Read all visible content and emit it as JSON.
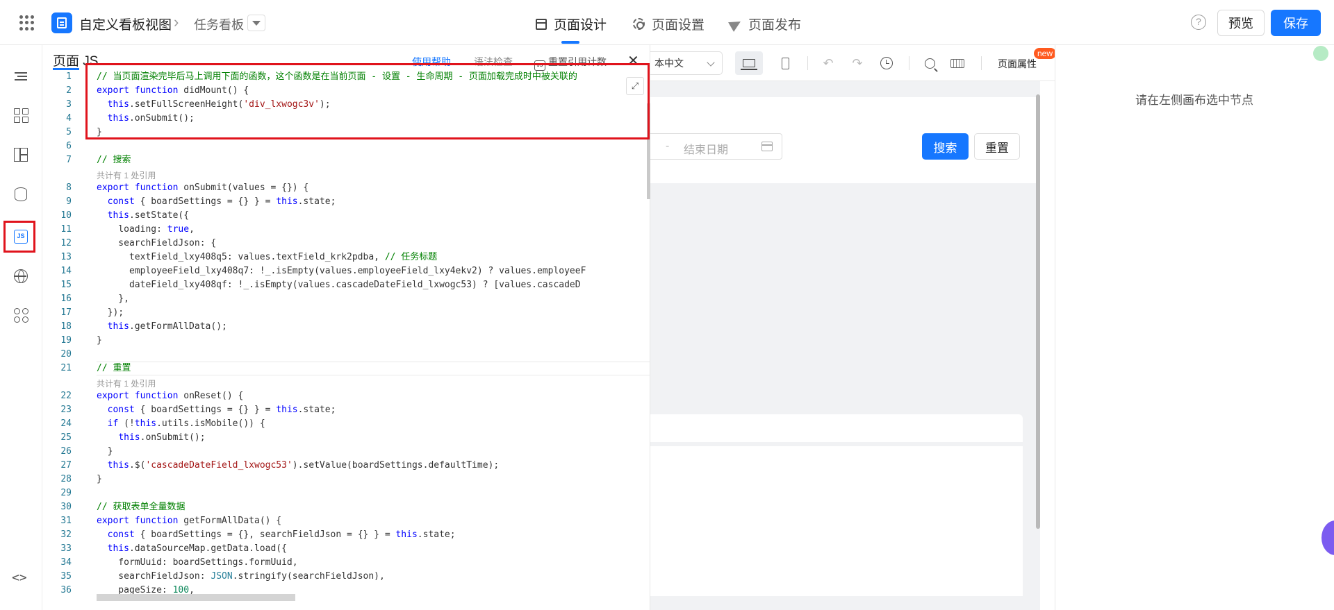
{
  "topbar": {
    "app_title": "自定义看板视图",
    "breadcrumb_sep": "›",
    "sub_title": "任务看板",
    "nav": [
      {
        "label": "页面设计"
      },
      {
        "label": "页面设置"
      },
      {
        "label": "页面发布"
      }
    ],
    "help": "?",
    "preview_label": "预览",
    "save_label": "保存"
  },
  "js_panel": {
    "title": "页面 JS",
    "help_link": "使用帮助",
    "lint": "语法检查",
    "ref_count": "重置引用计数",
    "close": "✕",
    "expand": "⤢"
  },
  "code": {
    "ref_note": "共计有 1 处引用",
    "lines": [
      {
        "n": "1",
        "t": "// 当页面渲染完毕后马上调用下面的函数，这个函数是在当前页面 - 设置 - 生命周期 - 页面加载完成时中被关联的"
      },
      {
        "n": "2",
        "t": "export function didMount() {"
      },
      {
        "n": "3",
        "t": "  this.setFullScreenHeight('div_lxwogc3v');"
      },
      {
        "n": "4",
        "t": "  this.onSubmit();"
      },
      {
        "n": "5",
        "t": "}"
      },
      {
        "n": "6",
        "t": ""
      },
      {
        "n": "7",
        "t": "// 搜索"
      },
      {
        "n": "8",
        "t": "export function onSubmit(values = {}) {"
      },
      {
        "n": "9",
        "t": "  const { boardSettings = {} } = this.state;"
      },
      {
        "n": "10",
        "t": "  this.setState({"
      },
      {
        "n": "11",
        "t": "    loading: true,"
      },
      {
        "n": "12",
        "t": "    searchFieldJson: {"
      },
      {
        "n": "13",
        "t": "      textField_lxy408q5: values.textField_krk2pdba, // 任务标题"
      },
      {
        "n": "14",
        "t": "      employeeField_lxy408q7: !_.isEmpty(values.employeeField_lxy4ekv2) ? values.employeeF"
      },
      {
        "n": "15",
        "t": "      dateField_lxy408qf: !_.isEmpty(values.cascadeDateField_lxwogc53) ? [values.cascadeD"
      },
      {
        "n": "16",
        "t": "    },"
      },
      {
        "n": "17",
        "t": "  });"
      },
      {
        "n": "18",
        "t": "  this.getFormAllData();"
      },
      {
        "n": "19",
        "t": "}"
      },
      {
        "n": "20",
        "t": ""
      },
      {
        "n": "21",
        "t": "// 重置"
      },
      {
        "n": "22",
        "t": "export function onReset() {"
      },
      {
        "n": "23",
        "t": "  const { boardSettings = {} } = this.state;"
      },
      {
        "n": "24",
        "t": "  if (!this.utils.isMobile()) {"
      },
      {
        "n": "25",
        "t": "    this.onSubmit();"
      },
      {
        "n": "26",
        "t": "  }"
      },
      {
        "n": "27",
        "t": "  this.$('cascadeDateField_lxwogc53').setValue(boardSettings.defaultTime);"
      },
      {
        "n": "28",
        "t": "}"
      },
      {
        "n": "29",
        "t": ""
      },
      {
        "n": "30",
        "t": "// 获取表单全量数据"
      },
      {
        "n": "31",
        "t": "export function getFormAllData() {"
      },
      {
        "n": "32",
        "t": "  const { boardSettings = {}, searchFieldJson = {} } = this.state;"
      },
      {
        "n": "33",
        "t": "  this.dataSourceMap.getData.load({"
      },
      {
        "n": "34",
        "t": "    formUuid: boardSettings.formUuid,"
      },
      {
        "n": "35",
        "t": "    searchFieldJson: JSON.stringify(searchFieldJson),"
      },
      {
        "n": "36",
        "t": "    pageSize: 100,"
      }
    ]
  },
  "canvas": {
    "lang": "本中文",
    "page_prop": "页面属性",
    "new_badge": "new",
    "date_dash": "-",
    "date_end": "结束日期",
    "search_label": "搜索",
    "reset_label": "重置"
  },
  "right_panel": {
    "tip": "请在左侧画布选中节点"
  },
  "sidebar": {
    "js_label": "JS",
    "code_toggle": "<>"
  }
}
